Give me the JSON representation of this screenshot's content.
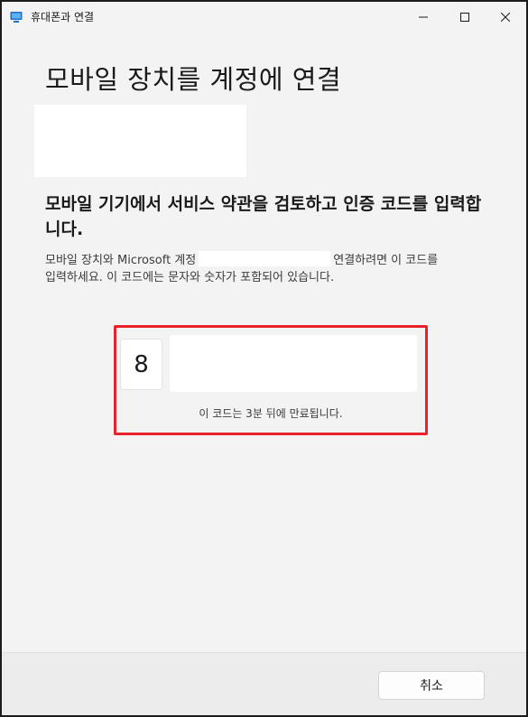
{
  "window": {
    "title": "휴대폰과 연결",
    "icon": "phone-link-app-icon",
    "controls": [
      "minimize-icon",
      "maximize-icon",
      "close-icon"
    ]
  },
  "main": {
    "title": "모바일 장치를 계정에 연결",
    "subheading": "모바일 기기에서 서비스 약관을 검토하고 인증 코드를 입력합니다.",
    "description_line1_a": "모바일 장치와 Microsoft 계정",
    "description_line1_b": "연결하려면 이 코드를",
    "description_line2": "입력하세요. 이 코드에는 문자와 숫자가 포함되어 있습니다."
  },
  "code": {
    "first_char": "8",
    "expire_text": "이 코드는 3분 뒤에 만료됩니다.",
    "highlight_color": "#e8212a"
  },
  "footer": {
    "cancel_label": "취소"
  }
}
